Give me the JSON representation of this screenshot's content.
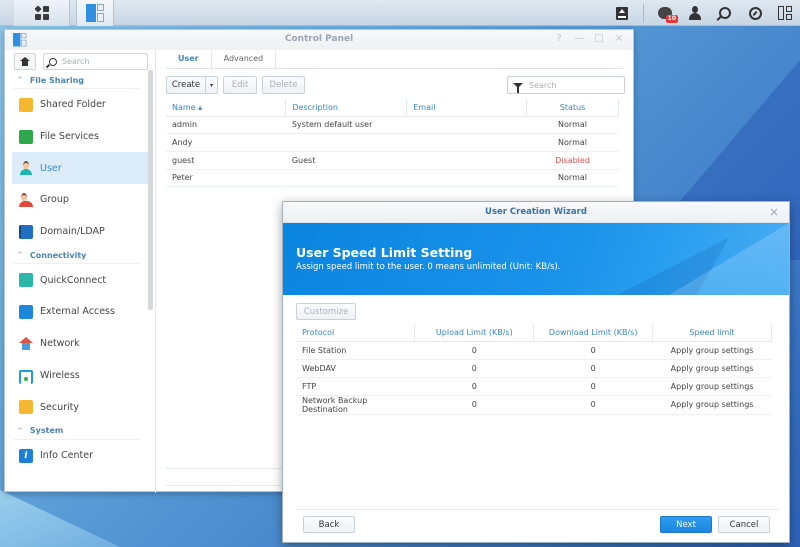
{
  "taskbar": {
    "left_buttons": [
      {
        "name": "main-menu",
        "icon": "grid-icon"
      },
      {
        "name": "control-panel",
        "icon": "control-panel-icon"
      }
    ],
    "right_icons": [
      {
        "name": "upload-icon"
      },
      {
        "name": "notifications-icon",
        "badge": "10"
      },
      {
        "name": "user-icon"
      },
      {
        "name": "search-icon"
      },
      {
        "name": "resource-monitor-icon"
      },
      {
        "name": "widgets-icon"
      }
    ]
  },
  "control_panel": {
    "title": "Control Panel",
    "window_controls": {
      "help": "?",
      "minimize": "—",
      "maximize": "□",
      "close": "×"
    },
    "sidebar": {
      "search_placeholder": "Search",
      "sections": [
        {
          "label": "File Sharing",
          "items": [
            {
              "label": "Shared Folder",
              "icon": "shared-folder-icon"
            },
            {
              "label": "File Services",
              "icon": "file-services-icon"
            },
            {
              "label": "User",
              "icon": "user-icon",
              "active": true
            },
            {
              "label": "Group",
              "icon": "group-icon"
            },
            {
              "label": "Domain/LDAP",
              "icon": "domain-ldap-icon"
            }
          ]
        },
        {
          "label": "Connectivity",
          "items": [
            {
              "label": "QuickConnect",
              "icon": "quickconnect-icon"
            },
            {
              "label": "External Access",
              "icon": "external-access-icon"
            },
            {
              "label": "Network",
              "icon": "network-icon"
            },
            {
              "label": "Wireless",
              "icon": "wireless-icon"
            },
            {
              "label": "Security",
              "icon": "security-icon"
            }
          ]
        },
        {
          "label": "System",
          "items": [
            {
              "label": "Info Center",
              "icon": "info-center-icon"
            }
          ]
        }
      ]
    },
    "tabs": [
      {
        "label": "User",
        "active": true
      },
      {
        "label": "Advanced",
        "active": false
      }
    ],
    "toolbar": {
      "create": "Create",
      "create_dropdown": "▾",
      "edit": "Edit",
      "delete": "Delete",
      "search_placeholder": "Search"
    },
    "table": {
      "columns": [
        "Name ▴",
        "Description",
        "Email",
        "Status"
      ],
      "rows": [
        {
          "name": "admin",
          "description": "System default user",
          "email": "",
          "status": "Normal"
        },
        {
          "name": "Andy",
          "description": "",
          "email": "",
          "status": "Normal"
        },
        {
          "name": "guest",
          "description": "Guest",
          "email": "",
          "status": "Disabled"
        },
        {
          "name": "Peter",
          "description": "",
          "email": "",
          "status": "Normal"
        }
      ]
    }
  },
  "wizard": {
    "title": "User Creation Wizard",
    "close": "×",
    "heading": "User Speed Limit Setting",
    "subheading": "Assign speed limit to the user. 0 means unlimited (Unit: KB/s).",
    "customize_button": "Customize",
    "table": {
      "columns": [
        "Protocol",
        "Upload Limit (KB/s)",
        "Download Limit (KB/s)",
        "Speed limit"
      ],
      "rows": [
        {
          "protocol": "File Station",
          "upload": "0",
          "download": "0",
          "speed_limit": "Apply group settings"
        },
        {
          "protocol": "WebDAV",
          "upload": "0",
          "download": "0",
          "speed_limit": "Apply group settings"
        },
        {
          "protocol": "FTP",
          "upload": "0",
          "download": "0",
          "speed_limit": "Apply group settings"
        },
        {
          "protocol": "Network Backup Destination",
          "upload": "0",
          "download": "0",
          "speed_limit": "Apply group settings"
        }
      ]
    },
    "buttons": {
      "back": "Back",
      "next": "Next",
      "cancel": "Cancel"
    }
  }
}
